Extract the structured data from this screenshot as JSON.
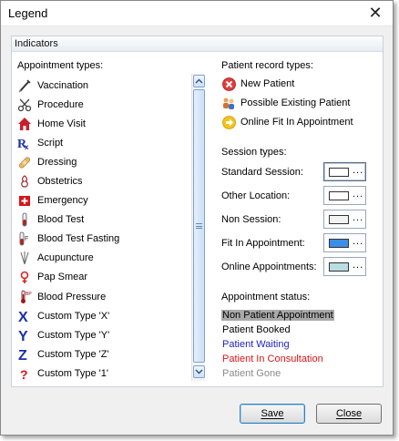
{
  "window": {
    "title": "Legend",
    "close_glyph": "✕"
  },
  "group": {
    "title": "Indicators"
  },
  "appointment_types": {
    "heading": "Appointment types:",
    "items": [
      {
        "label": "Vaccination",
        "icon": "syringe-icon"
      },
      {
        "label": "Procedure",
        "icon": "scissors-icon"
      },
      {
        "label": "Home Visit",
        "icon": "house-icon"
      },
      {
        "label": "Script",
        "icon": "rx-icon"
      },
      {
        "label": "Dressing",
        "icon": "bandage-icon"
      },
      {
        "label": "Obstetrics",
        "icon": "pregnancy-icon"
      },
      {
        "label": "Emergency",
        "icon": "first-aid-icon"
      },
      {
        "label": "Blood Test",
        "icon": "test-tube-icon"
      },
      {
        "label": "Blood Test Fasting",
        "icon": "fasting-tube-icon"
      },
      {
        "label": "Acupuncture",
        "icon": "needles-icon"
      },
      {
        "label": "Pap Smear",
        "icon": "female-symbol-icon"
      },
      {
        "label": "Blood Pressure",
        "icon": "thermometer-icon"
      },
      {
        "label": "Custom Type 'X'",
        "icon": "letter-x-icon"
      },
      {
        "label": "Custom Type 'Y'",
        "icon": "letter-y-icon"
      },
      {
        "label": "Custom Type 'Z'",
        "icon": "letter-z-icon"
      },
      {
        "label": "Custom Type '1'",
        "icon": "question-mark-icon"
      }
    ]
  },
  "patient_record_types": {
    "heading": "Patient record types:",
    "items": [
      {
        "label": "New Patient",
        "icon": "red-x-circle-icon"
      },
      {
        "label": "Possible Existing Patient",
        "icon": "people-icon"
      },
      {
        "label": "Online Fit In Appointment",
        "icon": "yellow-arrow-circle-icon"
      }
    ]
  },
  "session_types": {
    "heading": "Session types:",
    "dots": "...",
    "items": [
      {
        "label": "Standard Session:",
        "color": "#ffffff"
      },
      {
        "label": "Other Location:",
        "color": "#ffffff"
      },
      {
        "label": "Non Session:",
        "color": "#f2f2f2"
      },
      {
        "label": "Fit In Appointment:",
        "color": "#3b8ee8"
      },
      {
        "label": "Online Appointments:",
        "color": "#b9dde0"
      }
    ]
  },
  "appointment_status": {
    "heading": "Appointment status:",
    "items": [
      {
        "label": "Non Patient Appointment",
        "color": "#000000",
        "background": "#a9a9a9"
      },
      {
        "label": "Patient Booked",
        "color": "#000000",
        "background": ""
      },
      {
        "label": "Patient Waiting",
        "color": "#1f1fbf",
        "background": ""
      },
      {
        "label": "Patient In Consultation",
        "color": "#e01515",
        "background": ""
      },
      {
        "label": "Patient Gone",
        "color": "#8a8a8a",
        "background": ""
      }
    ]
  },
  "buttons": {
    "save_label": "Save",
    "close_label": "Close"
  }
}
